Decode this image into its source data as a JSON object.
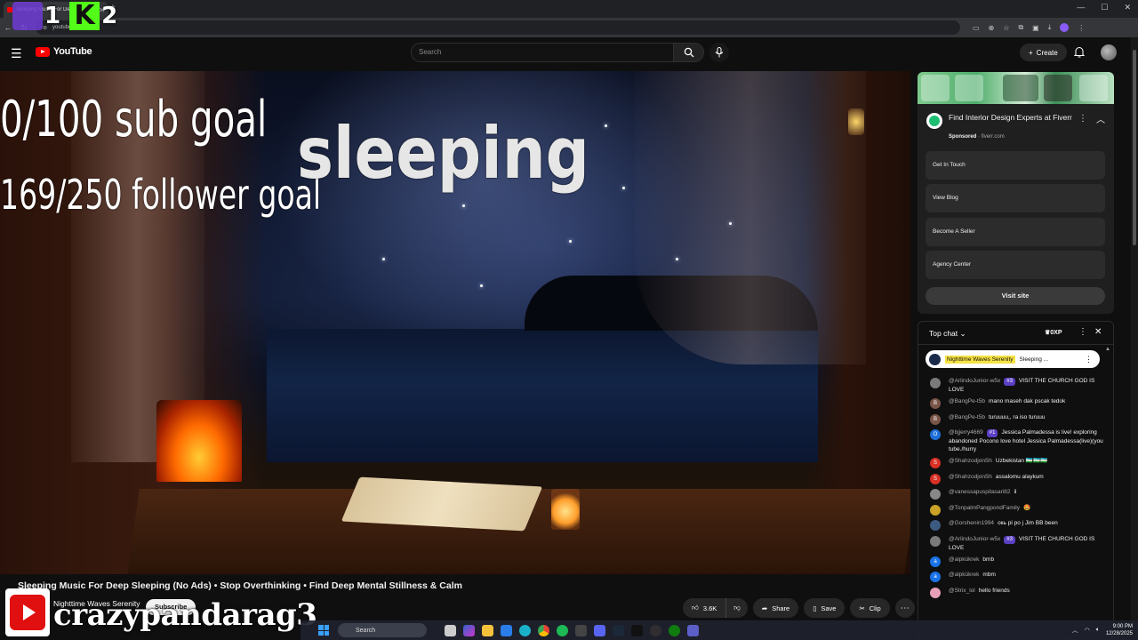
{
  "browser": {
    "tab_title": "Sleeping Music For Deep S",
    "url": "youtube.com/wa"
  },
  "stream_overlay": {
    "twitch_num": "1",
    "kick_letter": "K",
    "kick_num": "2",
    "sub_goal": "0/100 sub goal",
    "follower_goal": "169/250 follower goal",
    "streamer_name": "crazypandarag3"
  },
  "header": {
    "logo_text": "YouTube",
    "search_placeholder": "Search",
    "create_label": "Create"
  },
  "video": {
    "overlay_word": "sleeping",
    "title": "Sleeping Music For Deep Sleeping (No Ads) • Stop Overthinking • Find Deep Mental Stillness & Calm",
    "channel_name": "Nighttime Waves Serenity",
    "subscribe_label": "Subscribe",
    "likes": "3.6K",
    "share_label": "Share",
    "save_label": "Save",
    "clip_label": "Clip"
  },
  "ad": {
    "title": "Find Interior Design Experts at Fiverr",
    "sponsored": "Sponsored",
    "domain": "fiverr.com",
    "links": [
      "Get In Touch",
      "View Blog",
      "Become A Seller",
      "Agency Center"
    ],
    "visit_label": "Visit site"
  },
  "chat": {
    "header": "Top chat",
    "xp": "0XP",
    "pinned_author": "Nighttime Waves Serenity",
    "pinned_text": "Sleeping ...",
    "messages": [
      {
        "author": "@ArlindoJunior-w5x",
        "badge": "#3",
        "text": "VISIT THE CHURCH GOD IS LOVE",
        "initial": "",
        "color": "#7a7a7a"
      },
      {
        "author": "@BangPe-t5b",
        "badge": "",
        "text": "mano maseh dak pscak tedok",
        "initial": "B",
        "color": "#795548"
      },
      {
        "author": "@BangPe-t5b",
        "badge": "",
        "text": "turuuuu,, ra iso turuuu",
        "initial": "B",
        "color": "#795548"
      },
      {
        "author": "@bjjerry4669",
        "badge": "#1",
        "text": "Jessica Palmadessa is live! exploring abandoned Pocono love hotel Jessica Palmadessa(live)(you tube./hurry",
        "initial": "O",
        "color": "#1e6fd9"
      },
      {
        "author": "@ShahzodjonSh",
        "badge": "",
        "text": "Uzbekistan 🇺🇿🇺🇿🇺🇿",
        "initial": "S",
        "color": "#d93025"
      },
      {
        "author": "@ShahzodjonSh",
        "badge": "",
        "text": "assalomu alaykum",
        "initial": "S",
        "color": "#d93025"
      },
      {
        "author": "@vanessapuspitasari82",
        "badge": "",
        "text": "il",
        "initial": "",
        "color": "#888"
      },
      {
        "author": "@TonpalmPangpondFamily",
        "badge": "",
        "text": "🤩",
        "initial": "",
        "color": "#c9a227"
      },
      {
        "author": "@Gorshenin1994",
        "badge": "",
        "text": "окь рі ро j Jim BB been",
        "initial": "",
        "color": "#3d5a80"
      },
      {
        "author": "@ArlindoJunior-w5x",
        "badge": "#3",
        "text": "VISIT THE CHURCH GOD IS LOVE",
        "initial": "",
        "color": "#7a7a7a"
      },
      {
        "author": "@alpkükrek",
        "badge": "",
        "text": "bmb",
        "initial": "a",
        "color": "#1a73e8"
      },
      {
        "author": "@alpkükrek",
        "badge": "",
        "text": "mbm",
        "initial": "a",
        "color": "#1a73e8"
      },
      {
        "author": "@Strix_lol",
        "badge": "",
        "text": "hello friends",
        "initial": "",
        "color": "#e8a0b8"
      }
    ]
  },
  "taskbar": {
    "search_label": "Search",
    "time": "9:00 PM",
    "date": "12/28/2025"
  }
}
